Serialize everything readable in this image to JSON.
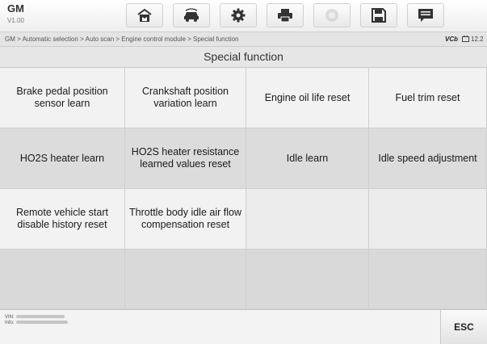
{
  "app": {
    "title": "GM",
    "version": "V1.00"
  },
  "toolbar": {
    "buttons": [
      {
        "name": "home-icon",
        "enabled": true
      },
      {
        "name": "vehicle-swap-icon",
        "enabled": true
      },
      {
        "name": "gear-icon",
        "enabled": true
      },
      {
        "name": "printer-icon",
        "enabled": true
      },
      {
        "name": "help-icon",
        "enabled": false
      },
      {
        "name": "save-icon",
        "enabled": true
      },
      {
        "name": "data-logging-icon",
        "enabled": true
      }
    ]
  },
  "breadcrumb": {
    "text": "GM > Automatic selection > Auto scan > Engine control module > Special function"
  },
  "status": {
    "vci": "VCb",
    "voltage": "12.2"
  },
  "page": {
    "title": "Special function"
  },
  "functions": [
    {
      "label": "Brake pedal position sensor learn"
    },
    {
      "label": "Crankshaft position variation learn"
    },
    {
      "label": "Engine oil life reset"
    },
    {
      "label": "Fuel trim reset"
    },
    {
      "label": "HO2S heater learn"
    },
    {
      "label": "HO2S heater resistance learned values reset"
    },
    {
      "label": "Idle learn"
    },
    {
      "label": "Idle speed adjustment"
    },
    {
      "label": "Remote vehicle start disable history reset"
    },
    {
      "label": "Throttle body idle air flow compensation reset"
    }
  ],
  "footer": {
    "vin_label": "VIN:",
    "info_label": "Info:",
    "esc_label": "ESC"
  },
  "colors": {
    "cell_light": "#f2f2f2",
    "cell_shade": "#dcdcdc",
    "toolbar_bg": "#eeeeee"
  }
}
